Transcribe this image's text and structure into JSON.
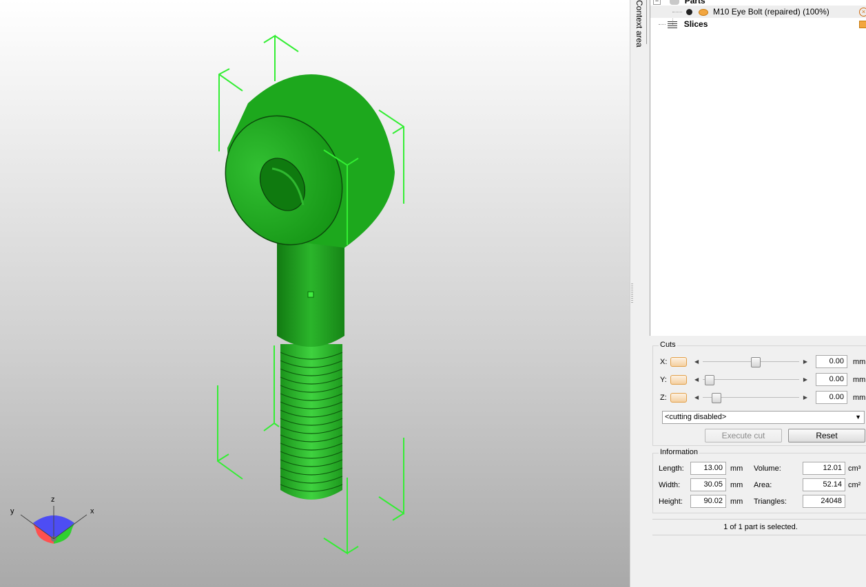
{
  "tree": {
    "parts_label": "Parts",
    "part_name": "M10 Eye Bolt (repaired) (100%)",
    "slices_label": "Slices"
  },
  "context_tab": "Context area",
  "cuts": {
    "title": "Cuts",
    "axes": [
      {
        "label": "X:",
        "value": "0.00",
        "unit": "mm",
        "slider_fraction": 0.55
      },
      {
        "label": "Y:",
        "value": "0.00",
        "unit": "mm",
        "slider_fraction": 0.02
      },
      {
        "label": "Z:",
        "value": "0.00",
        "unit": "mm",
        "slider_fraction": 0.1
      }
    ],
    "mode": "<cutting disabled>",
    "execute_label": "Execute cut",
    "reset_label": "Reset"
  },
  "information": {
    "title": "Information",
    "length_label": "Length:",
    "length_value": "13.00",
    "length_unit": "mm",
    "width_label": "Width:",
    "width_value": "30.05",
    "width_unit": "mm",
    "height_label": "Height:",
    "height_value": "90.02",
    "height_unit": "mm",
    "volume_label": "Volume:",
    "volume_value": "12.01",
    "volume_unit": "cm³",
    "area_label": "Area:",
    "area_value": "52.14",
    "area_unit": "cm²",
    "triangles_label": "Triangles:",
    "triangles_value": "24048"
  },
  "status": "1 of 1 part is selected.",
  "axes_gizmo": {
    "x": "x",
    "y": "y",
    "z": "z"
  },
  "colors": {
    "part": "#22b622",
    "bbox": "#33ee33",
    "accent": "#e2a04a"
  }
}
